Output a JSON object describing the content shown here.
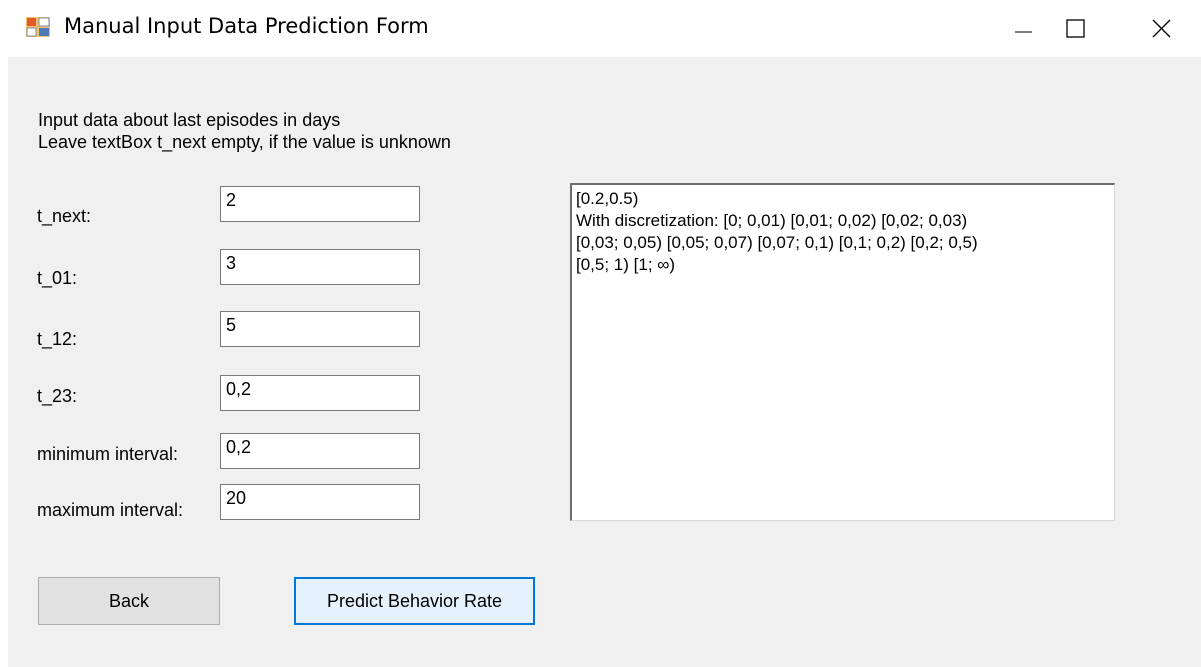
{
  "window": {
    "title": "Manual Input Data Prediction Form",
    "controls": {
      "minimize_icon": "minimize-icon",
      "maximize_icon": "maximize-icon",
      "close_icon": "close-icon"
    }
  },
  "form": {
    "instructions_line1": "Input data about last episodes in days",
    "instructions_line2": "Leave textBox t_next empty, if the value is unknown",
    "fields": [
      {
        "label": "t_next:",
        "value": "2"
      },
      {
        "label": "t_01:",
        "value": "3"
      },
      {
        "label": "t_12:",
        "value": "5"
      },
      {
        "label": "t_23:",
        "value": "0,2"
      },
      {
        "label": "minimum interval:",
        "value": "0,2"
      },
      {
        "label": "maximum interval:",
        "value": "20"
      }
    ],
    "output_text": "[0.2,0.5)\nWith discretization: [0; 0,01) [0,01; 0,02) [0,02; 0,03)\n[0,03; 0,05) [0,05; 0,07) [0,07; 0,1) [0,1; 0,2) [0,2; 0,5)\n[0,5; 1) [1; ∞)",
    "back_label": "Back",
    "predict_label": "Predict Behavior Rate"
  },
  "colors": {
    "client_bg": "#f0f0f0",
    "accent_focus": "#0078d7",
    "button_bg": "#e1e1e1"
  }
}
